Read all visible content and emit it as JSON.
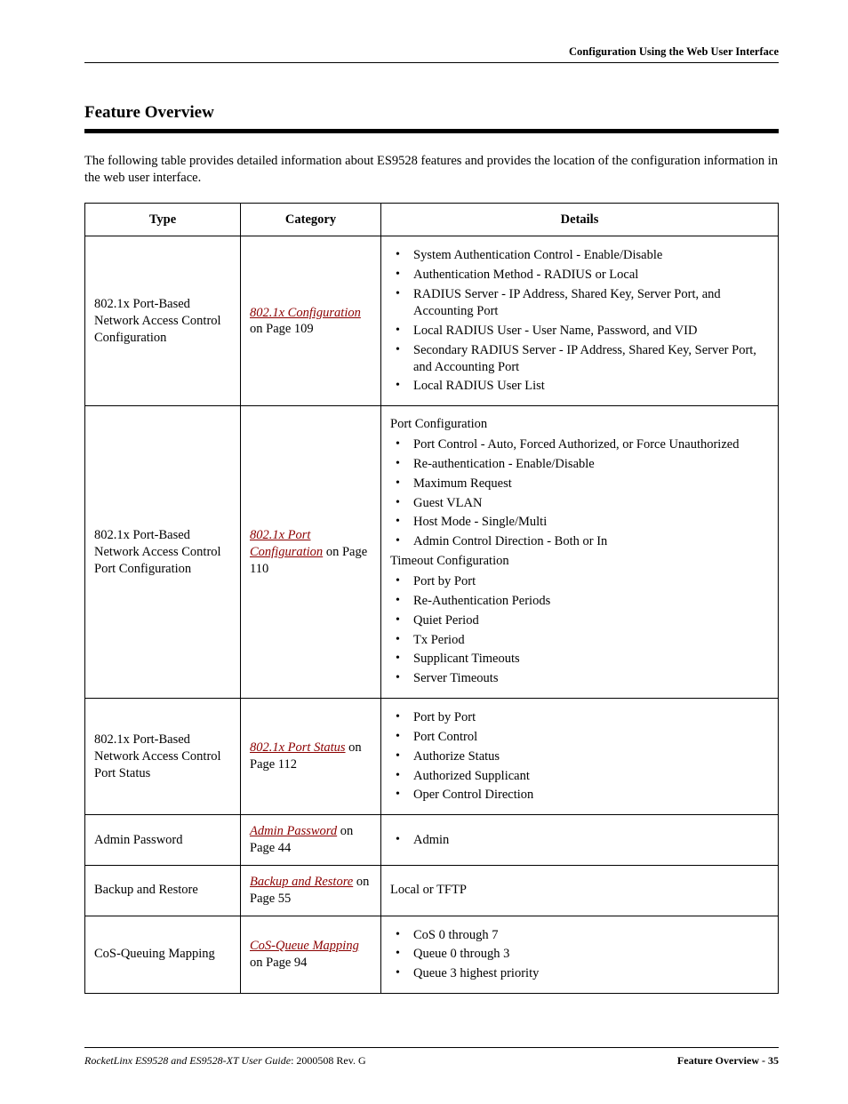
{
  "runningHead": "Configuration Using the Web User Interface",
  "sectionTitle": "Feature Overview",
  "intro": "The following table provides detailed information about ES9528 features and provides the location of the configuration information in the web user interface.",
  "columns": {
    "type": "Type",
    "category": "Category",
    "details": "Details"
  },
  "rows": [
    {
      "type": "802.1x Port-Based Network Access Control Configuration",
      "category": {
        "link": "802.1x Configuration",
        "suffix": " on Page 109"
      },
      "details": {
        "groups": [
          {
            "heading": null,
            "items": [
              "System Authentication Control - Enable/Disable",
              "Authentication Method - RADIUS or Local",
              "RADIUS Server - IP Address, Shared Key, Server Port, and Accounting Port",
              "Local RADIUS User - User Name, Password, and VID",
              "Secondary RADIUS Server - IP Address, Shared Key, Server Port, and Accounting Port",
              "Local RADIUS User List"
            ]
          }
        ]
      }
    },
    {
      "type": "802.1x Port-Based Network Access Control Port Configuration",
      "category": {
        "link": "802.1x Port Configuration",
        "suffix": " on Page 110"
      },
      "details": {
        "groups": [
          {
            "heading": "Port Configuration",
            "items": [
              "Port Control - Auto, Forced Authorized, or Force Unauthorized",
              "Re-authentication - Enable/Disable",
              "Maximum Request",
              "Guest VLAN",
              "Host Mode - Single/Multi",
              "Admin Control Direction - Both or In"
            ]
          },
          {
            "heading": "Timeout Configuration",
            "items": [
              "Port by Port",
              "Re-Authentication Periods",
              "Quiet Period",
              "Tx Period",
              "Supplicant Timeouts",
              "Server Timeouts"
            ]
          }
        ]
      }
    },
    {
      "type": "802.1x Port-Based Network Access Control Port Status",
      "category": {
        "link": "802.1x Port Status",
        "suffix": " on Page 112"
      },
      "details": {
        "groups": [
          {
            "heading": null,
            "items": [
              "Port by Port",
              "Port Control",
              "Authorize Status",
              "Authorized Supplicant",
              "Oper Control Direction"
            ]
          }
        ]
      }
    },
    {
      "type": "Admin Password",
      "category": {
        "link": "Admin Password",
        "suffix": " on Page 44"
      },
      "details": {
        "groups": [
          {
            "heading": null,
            "items": [
              "Admin"
            ]
          }
        ]
      }
    },
    {
      "type": "Backup and Restore",
      "category": {
        "link": "Backup and Restore",
        "suffix": " on Page 55"
      },
      "details": {
        "plain": "Local or TFTP"
      }
    },
    {
      "type": "CoS-Queuing Mapping",
      "category": {
        "link": "CoS-Queue Mapping",
        "suffix": " on Page 94"
      },
      "details": {
        "groups": [
          {
            "heading": null,
            "items": [
              "CoS 0 through 7",
              "Queue 0 through 3",
              "Queue 3 highest priority"
            ]
          }
        ]
      }
    }
  ],
  "footer": {
    "leftItalic": "RocketLinx ES9528 and ES9528-XT User Guide",
    "leftRest": ": 2000508 Rev. G",
    "right": "Feature Overview - 35"
  }
}
